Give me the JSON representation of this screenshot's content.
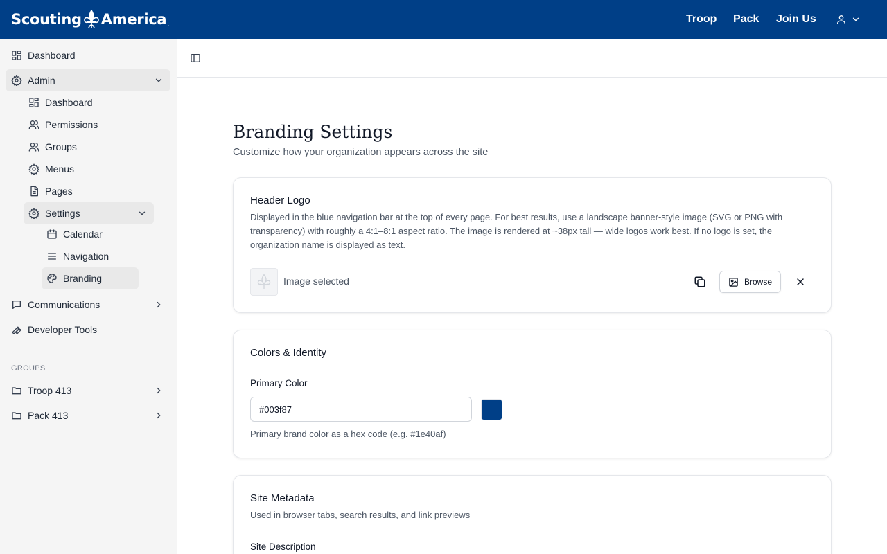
{
  "topbar": {
    "brand_left": "Scouting",
    "brand_right": "America",
    "brand_mark": ".",
    "nav": [
      "Troop",
      "Pack",
      "Join Us"
    ],
    "background": "#003f87"
  },
  "sidebar": {
    "items": [
      {
        "label": "Dashboard",
        "icon": "dashboard-icon"
      },
      {
        "label": "Admin",
        "icon": "gear-icon",
        "expanded": true
      },
      {
        "label": "Dashboard",
        "icon": "dashboard-icon"
      },
      {
        "label": "Permissions",
        "icon": "users-icon"
      },
      {
        "label": "Groups",
        "icon": "users-icon"
      },
      {
        "label": "Menus",
        "icon": "gear-icon"
      },
      {
        "label": "Pages",
        "icon": "file-icon"
      },
      {
        "label": "Settings",
        "icon": "gear-icon",
        "expanded": true
      },
      {
        "label": "Calendar",
        "icon": "calendar-icon"
      },
      {
        "label": "Navigation",
        "icon": "menu-lines-icon"
      },
      {
        "label": "Branding",
        "icon": "palette-icon",
        "active": true
      },
      {
        "label": "Communications",
        "icon": "message-icon"
      },
      {
        "label": "Developer Tools",
        "icon": "wrench-icon"
      }
    ],
    "groups_heading": "GROUPS",
    "groups": [
      {
        "label": "Troop 413",
        "icon": "folder-icon"
      },
      {
        "label": "Pack 413",
        "icon": "folder-icon"
      }
    ]
  },
  "page": {
    "title": "Branding Settings",
    "subtitle": "Customize how your organization appears across the site"
  },
  "header_logo": {
    "title": "Header Logo",
    "description": "Displayed in the blue navigation bar at the top of every page. For best results, use a landscape banner-style image (SVG or PNG with transparency) with roughly a 4:1–8:1 aspect ratio. The image is rendered at ~38px tall — wide logos work best. If no logo is set, the organization name is displayed as text.",
    "status": "Image selected",
    "browse_label": "Browse"
  },
  "colors": {
    "title": "Colors & Identity",
    "primary_label": "Primary Color",
    "primary_value": "#003f87",
    "primary_help": "Primary brand color as a hex code (e.g. #1e40af)",
    "swatch_color": "#003f87"
  },
  "metadata": {
    "title": "Site Metadata",
    "description": "Used in browser tabs, search results, and link previews",
    "site_description_label": "Site Description"
  }
}
